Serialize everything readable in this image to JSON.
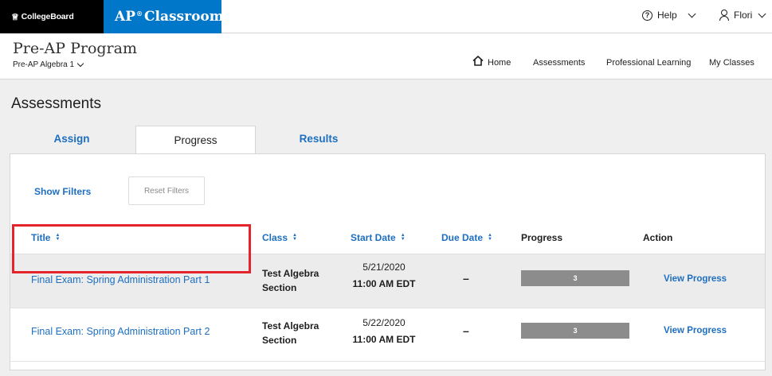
{
  "brand": {
    "collegeboard": "CollegeBoard",
    "ap_prefix": "AP",
    "ap_suffix": "Classroom"
  },
  "topbar": {
    "help_label": "Help",
    "user_name": "Flori"
  },
  "program": {
    "title": "Pre-AP Program",
    "course": "Pre-AP Algebra 1"
  },
  "nav": {
    "home": "Home",
    "assessments": "Assessments",
    "professional_learning": "Professional Learning",
    "my_classes": "My Classes"
  },
  "page": {
    "title": "Assessments"
  },
  "tabs": {
    "assign": "Assign",
    "progress": "Progress",
    "results": "Results"
  },
  "filters": {
    "show": "Show Filters",
    "reset": "Reset Filters"
  },
  "table": {
    "headers": {
      "title": "Title",
      "class": "Class",
      "start_date": "Start Date",
      "due_date": "Due Date",
      "progress": "Progress",
      "action": "Action"
    },
    "rows": [
      {
        "title": "Final Exam: Spring Administration Part 1",
        "class_line1": "Test Algebra",
        "class_line2": "Section",
        "start_date": "5/21/2020",
        "start_time": "11:00 AM EDT",
        "due_date": "–",
        "progress_value": "3",
        "action": "View Progress"
      },
      {
        "title": "Final Exam: Spring Administration Part 2",
        "class_line1": "Test Algebra",
        "class_line2": "Section",
        "start_date": "5/22/2020",
        "start_time": "11:00 AM EDT",
        "due_date": "–",
        "progress_value": "3",
        "action": "View Progress"
      }
    ]
  },
  "colors": {
    "ap_blue": "#0077c8",
    "link_blue": "#1e6fc0",
    "highlight_red": "#e5232b",
    "progress_gray": "#8c8c8c"
  },
  "icons": {
    "help": "help-circle-icon",
    "user": "user-icon",
    "home": "home-icon",
    "sort": "sort-arrows-icon",
    "chevron": "chevron-down-icon"
  }
}
